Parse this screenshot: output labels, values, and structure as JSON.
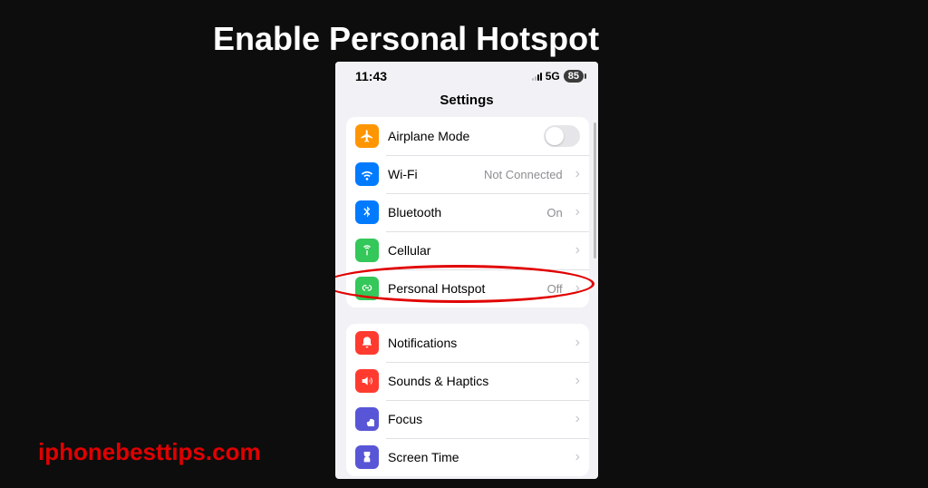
{
  "heading": "Enable Personal Hotspot",
  "watermark": "iphonebesttips.com",
  "status": {
    "time": "11:43",
    "network": "5G",
    "battery": "85"
  },
  "nav_title": "Settings",
  "group1": [
    {
      "label": "Airplane Mode",
      "value": "",
      "icon": "airplane-icon",
      "bg": "bg-orange",
      "control": "toggle"
    },
    {
      "label": "Wi-Fi",
      "value": "Not Connected",
      "icon": "wifi-icon",
      "bg": "bg-blue",
      "control": "chevron"
    },
    {
      "label": "Bluetooth",
      "value": "On",
      "icon": "bluetooth-icon",
      "bg": "bg-blue",
      "control": "chevron"
    },
    {
      "label": "Cellular",
      "value": "",
      "icon": "cellular-icon",
      "bg": "bg-green",
      "control": "chevron"
    },
    {
      "label": "Personal Hotspot",
      "value": "Off",
      "icon": "hotspot-icon",
      "bg": "bg-green",
      "control": "chevron"
    }
  ],
  "group2": [
    {
      "label": "Notifications",
      "value": "",
      "icon": "notifications-icon",
      "bg": "bg-red",
      "control": "chevron"
    },
    {
      "label": "Sounds & Haptics",
      "value": "",
      "icon": "sounds-icon",
      "bg": "bg-red",
      "control": "chevron"
    },
    {
      "label": "Focus",
      "value": "",
      "icon": "focus-icon",
      "bg": "bg-purple",
      "control": "chevron"
    },
    {
      "label": "Screen Time",
      "value": "",
      "icon": "screentime-icon",
      "bg": "bg-purple",
      "control": "chevron"
    }
  ]
}
